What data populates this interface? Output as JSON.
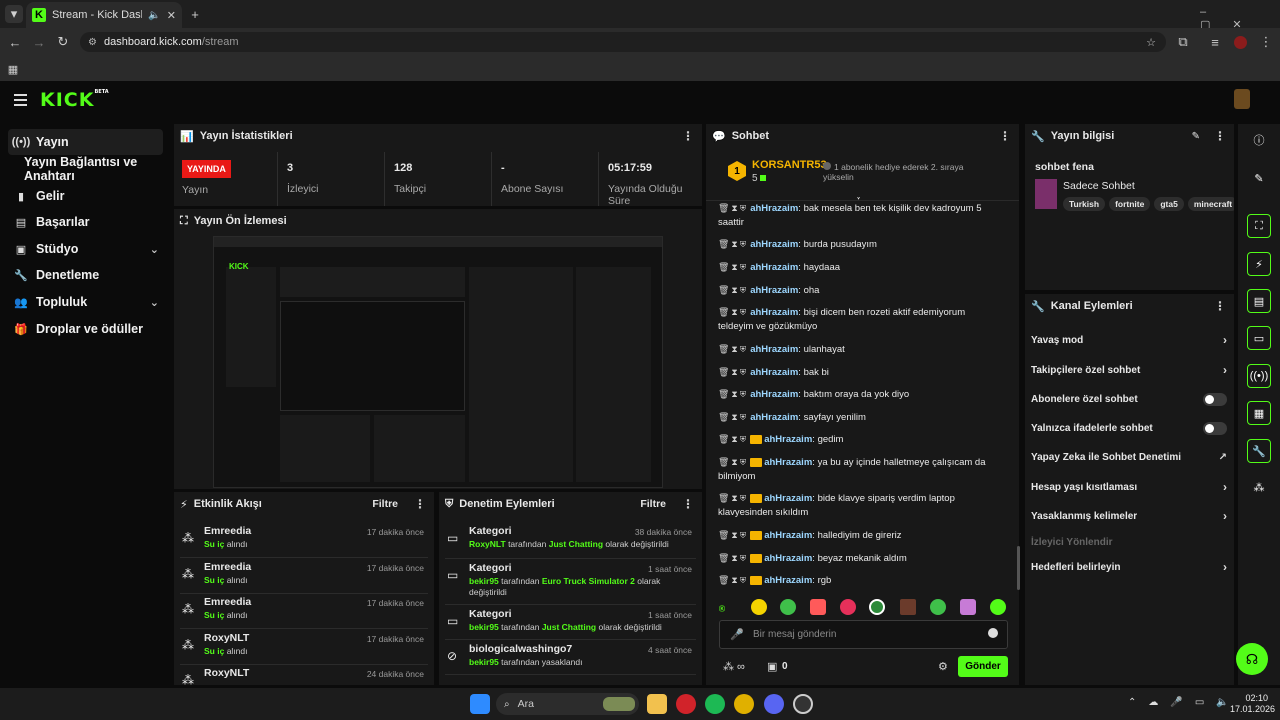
{
  "browser": {
    "tab_title": "Stream - Kick Dashboard",
    "url_host": "dashboard.kick.com",
    "url_path": "/stream"
  },
  "app": {
    "logo": "KICK",
    "logo_badge": "BETA"
  },
  "sidebar": {
    "items": [
      {
        "label": "Yayın",
        "icon": "broadcast-icon"
      },
      {
        "label": "Yayın Bağlantısı ve Anahtarı"
      },
      {
        "label": "Gelir",
        "icon": "revenue-icon"
      },
      {
        "label": "Başarılar",
        "icon": "achievements-icon"
      },
      {
        "label": "Stüdyo",
        "icon": "studio-icon"
      },
      {
        "label": "Denetleme",
        "icon": "wrench-icon"
      },
      {
        "label": "Topluluk",
        "icon": "community-icon"
      },
      {
        "label": "Droplar ve ödüller",
        "icon": "drops-icon"
      }
    ]
  },
  "stats": {
    "title": "Yayın İstatistikleri",
    "live_badge": "YAYINDA",
    "cells": [
      {
        "value": "",
        "label": "Yayın"
      },
      {
        "value": "3",
        "label": "İzleyici"
      },
      {
        "value": "128",
        "label": "Takipçi"
      },
      {
        "value": "-",
        "label": "Abone Sayısı"
      },
      {
        "value": "05:17:59",
        "label": "Yayında Olduğu Süre"
      }
    ]
  },
  "preview": {
    "title": "Yayın Ön İzlemesi"
  },
  "activity": {
    "title": "Etkinlik Akışı",
    "filter": "Filtre",
    "items": [
      {
        "name": "Emreedia",
        "action": "Su iç",
        "suffix": "alındı",
        "time": "17 dakika önce"
      },
      {
        "name": "Emreedia",
        "action": "Su iç",
        "suffix": "alındı",
        "time": "17 dakika önce"
      },
      {
        "name": "Emreedia",
        "action": "Su iç",
        "suffix": "alındı",
        "time": "17 dakika önce"
      },
      {
        "name": "RoxyNLT",
        "action": "Su iç",
        "suffix": "alındı",
        "time": "17 dakika önce"
      },
      {
        "name": "RoxyNLT",
        "action": "",
        "suffix": "",
        "time": "24 dakika önce"
      }
    ]
  },
  "moderation": {
    "title": "Denetim Eylemleri",
    "filter": "Filtre",
    "items": [
      {
        "name": "Kategori",
        "time": "38 dakika önce",
        "user": "RoxyNLT",
        "mid": "tarafından",
        "target": "Just Chatting",
        "end": "olarak değiştirildi"
      },
      {
        "name": "Kategori",
        "time": "1 saat önce",
        "user": "bekir95",
        "mid": "tarafından",
        "target": "Euro Truck Simulator 2",
        "end": "olarak değiştirildi"
      },
      {
        "name": "Kategori",
        "time": "1 saat önce",
        "user": "bekir95",
        "mid": "tarafından",
        "target": "Just Chatting",
        "end": "olarak değiştirildi"
      },
      {
        "name": "biologicalwashingo7",
        "time": "4 saat önce",
        "user": "bekir95",
        "mid": "tarafından yasaklandı",
        "target": "",
        "end": ""
      }
    ]
  },
  "chat": {
    "title": "Sohbet",
    "pinned_user": "KORSANTR53",
    "pinned_count": "5",
    "pinned_rank": "1",
    "pinned_text": "1 abonelik hediye ederek 2. sıraya yükselin",
    "messages": [
      {
        "user": "ahHrazaim",
        "text": "bak mesela ben tek kişilik dev kadroyum 5 saattir",
        "crown": false
      },
      {
        "user": "ahHrazaim",
        "text": "burda pusudayım",
        "crown": false
      },
      {
        "user": "ahHrazaim",
        "text": "haydaaa",
        "crown": false
      },
      {
        "user": "ahHrazaim",
        "text": "oha",
        "crown": false
      },
      {
        "user": "ahHrazaim",
        "text": "bişi dicem ben rozeti aktif edemiyorum teldeyim ve gözükmüyo",
        "crown": false
      },
      {
        "user": "ahHrazaim",
        "text": "ulanhayat",
        "crown": false
      },
      {
        "user": "ahHrazaim",
        "text": "bak bi",
        "crown": false
      },
      {
        "user": "ahHrazaim",
        "text": "baktım oraya da yok diyo",
        "crown": false
      },
      {
        "user": "ahHrazaim",
        "text": "sayfayı yenilim",
        "crown": false
      },
      {
        "user": "ahHrazaim",
        "text": "gedim",
        "crown": true
      },
      {
        "user": "ahHrazaim",
        "text": "ya bu ay içinde halletmeye çalışıcam da bilmiyom",
        "crown": true
      },
      {
        "user": "ahHrazaim",
        "text": "bide klavye sipariş verdim laptop klavyesinden sıkıldım",
        "crown": true
      },
      {
        "user": "ahHrazaim",
        "text": "hallediyim de gireriz",
        "crown": true
      },
      {
        "user": "ahHrazaim",
        "text": "beyaz mekanik aldım",
        "crown": true
      },
      {
        "user": "ahHrazaim",
        "text": "rgb",
        "crown": true
      }
    ],
    "input_placeholder": "Bir mesaj gönderin",
    "points": "0",
    "send": "Gönder"
  },
  "stream_info": {
    "title": "Yayın bilgisi",
    "stream_title": "sohbet fena",
    "category": "Sadece Sohbet",
    "tags": [
      "Turkish",
      "fortnite",
      "gta5",
      "minecraft"
    ]
  },
  "channel_actions": {
    "title": "Kanal Eylemleri",
    "items": [
      {
        "label": "Yavaş mod",
        "control": "arrow"
      },
      {
        "label": "Takipçilere özel sohbet",
        "control": "arrow"
      },
      {
        "label": "Abonelere özel sohbet",
        "control": "toggle"
      },
      {
        "label": "Yalnızca ifadelerle sohbet",
        "control": "toggle"
      },
      {
        "label": "Yapay Zeka ile Sohbet Denetimi",
        "control": "external"
      },
      {
        "label": "Hesap yaşı kısıtlaması",
        "control": "arrow"
      },
      {
        "label": "Yasaklanmış kelimeler",
        "control": "arrow"
      },
      {
        "label": "İzleyici Yönlendir",
        "control": "none",
        "disabled": true
      },
      {
        "label": "Hedefleri belirleyin",
        "control": "arrow"
      }
    ]
  },
  "taskbar": {
    "search": "Ara",
    "time": "02:10",
    "date": "17.01.2026"
  },
  "colors": {
    "accent": "#53fc18",
    "live": "#e91916",
    "username": "#9dd7ff",
    "panel": "#181818"
  }
}
